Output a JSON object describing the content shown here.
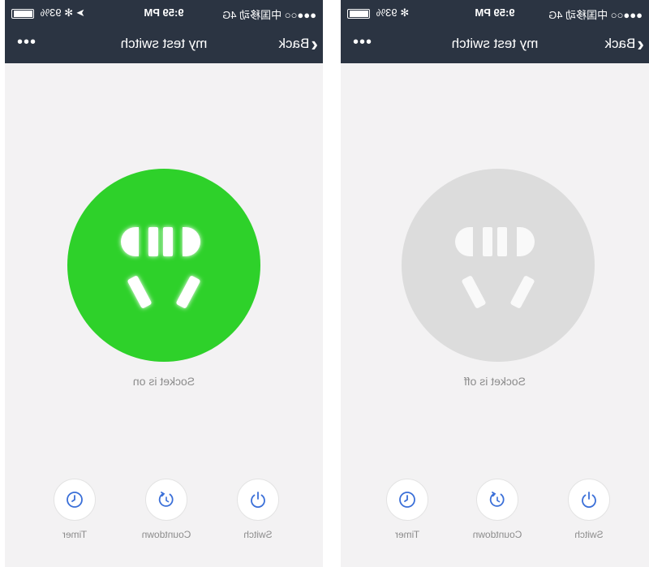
{
  "status_bar": {
    "carrier": "●●●○○ 中国移动",
    "network": "4G",
    "time": "9:59 PM",
    "left_indicators": "➤ ✻",
    "right_indicators": "✻",
    "battery": "93%"
  },
  "nav": {
    "back_label": "Back",
    "title": "my test switch",
    "more": "•••"
  },
  "screens": [
    {
      "status": "Socket is on",
      "state": "on",
      "color": "#2ed12a"
    },
    {
      "status": "Socket is off",
      "state": "off",
      "color": "#dcdcdc"
    }
  ],
  "actions": {
    "switch": "Switch",
    "countdown": "Countdown",
    "timer": "Timer"
  },
  "colors": {
    "bar": "#2b3442",
    "background": "#f3f2f3",
    "on_green": "#2ed12a",
    "off_grey": "#dcdcdc",
    "icon_blue": "#3a6fd8"
  },
  "icons": [
    "chevron-left-icon",
    "more-dots-icon",
    "socket-icon",
    "power-icon",
    "countdown-icon",
    "clock-icon",
    "battery-icon"
  ]
}
